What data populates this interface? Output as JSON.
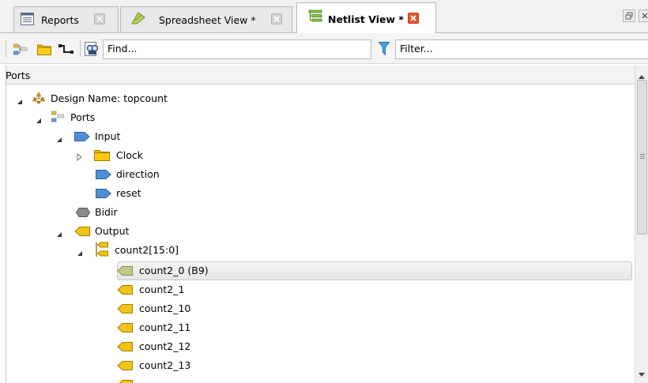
{
  "tabs": [
    {
      "label": "Reports",
      "icon": "report-icon",
      "active": false
    },
    {
      "label": "Spreadsheet View *",
      "icon": "spreadsheet-icon",
      "active": false
    },
    {
      "label": "Netlist View *",
      "icon": "netlist-icon",
      "active": true
    }
  ],
  "toolbar": {
    "find_placeholder": "Find...",
    "filter_placeholder": "Filter..."
  },
  "panel": {
    "title": "Ports"
  },
  "tree": {
    "design": "Design Name: topcount",
    "ports": "Ports",
    "input": "Input",
    "clock": "Clock",
    "direction": "direction",
    "reset": "reset",
    "bidir": "Bidir",
    "output": "Output",
    "bus": "count2[15:0]",
    "items": [
      "count2_0 (B9)",
      "count2_1",
      "count2_10",
      "count2_11",
      "count2_12",
      "count2_13"
    ]
  },
  "colors": {
    "input_port": "#4f8fd6",
    "output_port": "#f2c21b",
    "folder": "#f3b800",
    "close_active": "#e8542f"
  }
}
